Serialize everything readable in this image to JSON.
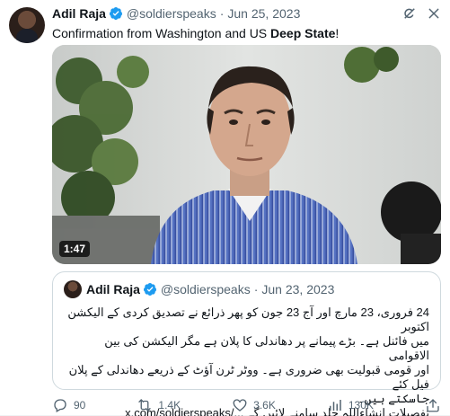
{
  "tweet": {
    "author_name": "Adil Raja",
    "handle": "@soldierspeaks",
    "separator": "·",
    "date": "Jun 25, 2023",
    "text_prefix": "Confirmation from Washington and US ",
    "text_bold": "Deep State",
    "text_suffix": "!",
    "video_duration": "1:47"
  },
  "quote": {
    "author_name": "Adil Raja",
    "handle": "@soldierspeaks",
    "separator": "·",
    "date": "Jun 23, 2023",
    "lines": [
      "24 فروری، 23 مارچ اور آج 23 جون کو پھر ذرائع نے تصدیق کردی کے الیکشن اکتوبر",
      "میں فائنل ہے۔ بڑے پیمانے پر دھاندلی کا پلان ہے مگر الیکشن کی بین الاقوامی",
      "اور قومی قبولیت بھی ضروری ہے۔ ووٹر ٹرن آؤٹ کے ذریعے دھاندلی کے پلان فیل کئے",
      "جاسکتے ہیں۔"
    ],
    "last_line_text": "تفصیلات انشاءاللہ جلد سامنے لائیں گے ",
    "last_line_link": "x.com/soldierspeaks/..."
  },
  "actions": {
    "replies": "90",
    "reposts": "1.4K",
    "likes": "3.6K",
    "views": "130K"
  },
  "icons": {
    "header": [
      "grok-icon",
      "close-icon"
    ],
    "actions": [
      "reply-icon",
      "repost-icon",
      "like-icon",
      "views-icon",
      "share-icon"
    ]
  },
  "colors": {
    "verified": "#1d9bf0",
    "text_primary": "#0f1419",
    "text_secondary": "#536471",
    "border": "#cfd9de"
  }
}
